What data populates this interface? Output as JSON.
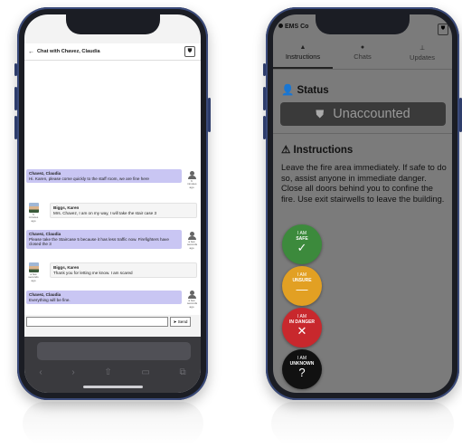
{
  "left_phone": {
    "header": {
      "title": "Chat with Chavez, Claudia"
    },
    "messages": [
      {
        "sender": "Chavez, Claudia",
        "text": "Hi. Karen, please come quickly to the staff room, we are fine here",
        "time": "6 minutes ago"
      },
      {
        "sender": "Biggs, Karen",
        "text": "Mrs. Chavez, I am on my way, I will take the stair case 3",
        "time": "5 minutes ago"
      },
      {
        "sender": "Chavez, Claudia",
        "text": "Please take the Staircase 5 because it has less traffic now. Firefighters have closed the 3",
        "time": "a few seconds ago"
      },
      {
        "sender": "Biggs, Karen",
        "text": "Thank you for letting me know. I am scared",
        "time": "a few seconds ago"
      },
      {
        "sender": "Chavez, Claudia",
        "text": "Everything will be fine.",
        "time": "a few seconds ago"
      }
    ],
    "input": {
      "value": "",
      "send_label": "Send"
    }
  },
  "right_phone": {
    "app_title": "EMS Co",
    "tabs": [
      {
        "label": "Instructions",
        "icon": "triangle-icon"
      },
      {
        "label": "Chats",
        "icon": "chat-bubble-icon"
      },
      {
        "label": "Updates",
        "icon": "pin-icon"
      }
    ],
    "status": {
      "heading": "Status",
      "value": "Unaccounted"
    },
    "instructions": {
      "heading": "Instructions",
      "text": "Leave the fire area immediately. If safe to do so, assist anyone in immediate danger. Close all doors behind you to confine the fire. Use exit stairwells to leave the building."
    },
    "actions": [
      {
        "line1": "I AM",
        "line2": "SAFE",
        "symbol": "✓",
        "color": "#3c8a3c"
      },
      {
        "line1": "I AM",
        "line2": "UNSURE",
        "symbol": "—",
        "color": "#e2a023"
      },
      {
        "line1": "I AM",
        "line2": "IN DANGER",
        "symbol": "✕",
        "color": "#c8282d"
      },
      {
        "line1": "I AM",
        "line2": "UNKNOWN",
        "symbol": "?",
        "color": "#111111"
      }
    ]
  }
}
